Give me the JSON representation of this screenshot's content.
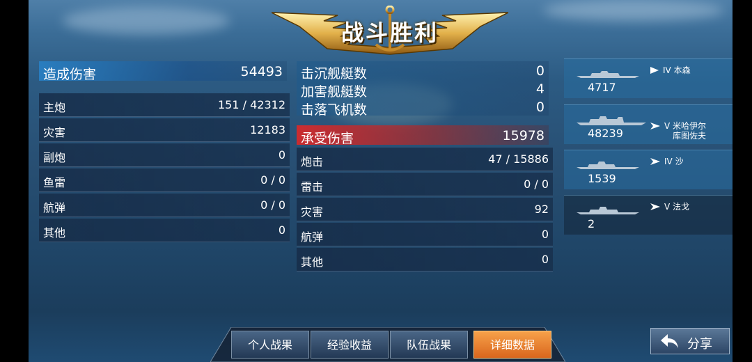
{
  "title": "战斗胜利",
  "damage_dealt": {
    "label": "造成伤害",
    "value": "54493",
    "rows": [
      {
        "label": "主炮",
        "value": "151 / 42312"
      },
      {
        "label": "灾害",
        "value": "12183"
      },
      {
        "label": "副炮",
        "value": "0"
      },
      {
        "label": "鱼雷",
        "value": "0 / 0"
      },
      {
        "label": "航弹",
        "value": "0 / 0"
      },
      {
        "label": "其他",
        "value": "0"
      }
    ]
  },
  "kills": [
    {
      "label": "击沉舰艇数",
      "value": "0"
    },
    {
      "label": "加害舰艇数",
      "value": "4"
    },
    {
      "label": "击落飞机数",
      "value": "0"
    }
  ],
  "damage_taken": {
    "label": "承受伤害",
    "value": "15978",
    "rows": [
      {
        "label": "炮击",
        "value": "47 / 15886"
      },
      {
        "label": "雷击",
        "value": "0 / 0"
      },
      {
        "label": "灾害",
        "value": "92"
      },
      {
        "label": "航弹",
        "value": "0"
      },
      {
        "label": "其他",
        "value": "0"
      }
    ]
  },
  "ships": [
    {
      "tier": "IV",
      "name": "本森",
      "value": "4717",
      "type_icon": "destroyer-icon"
    },
    {
      "tier": "V",
      "name": "米哈伊尔\n库图佐夫",
      "value": "48239",
      "type_icon": "cruiser-icon"
    },
    {
      "tier": "IV",
      "name": "沙",
      "value": "1539",
      "type_icon": "cruiser-icon"
    },
    {
      "tier": "V",
      "name": "法戈",
      "value": "2",
      "type_icon": "cruiser-icon"
    }
  ],
  "tabs": [
    {
      "label": "个人战果",
      "active": false
    },
    {
      "label": "经验收益",
      "active": false
    },
    {
      "label": "队伍战果",
      "active": false
    },
    {
      "label": "详细数据",
      "active": true
    }
  ],
  "share_label": "分享"
}
